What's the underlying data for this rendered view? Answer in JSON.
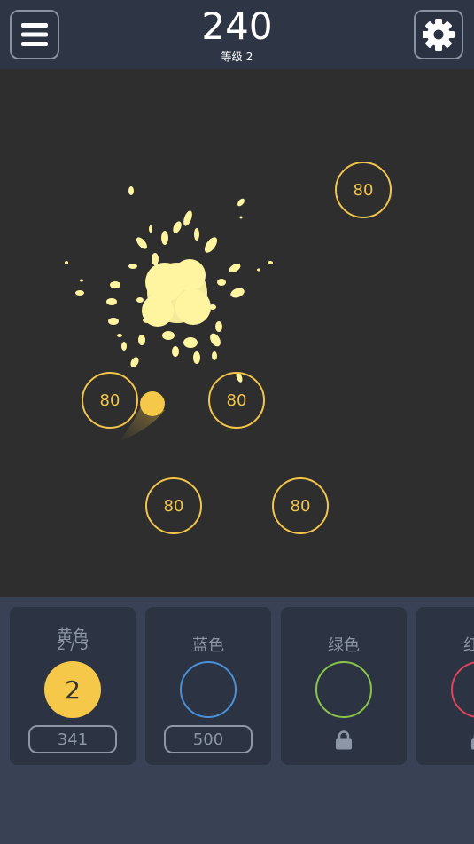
{
  "header": {
    "score": "240",
    "level_label": "等级",
    "level_value": "2",
    "menu_icon": "hamburger-menu-icon",
    "settings_icon": "gear-icon"
  },
  "field": {
    "blocks": [
      "80",
      "80",
      "80",
      "80",
      "80"
    ],
    "colors": {
      "background": "#2e2e2e",
      "block": "#f2c44a",
      "particles": "#fff5a0",
      "ball": "#f5c84a"
    }
  },
  "colors_panel": {
    "cards": [
      {
        "name": "黄色",
        "progress": "2 / 5",
        "level": "2",
        "price": "341",
        "color": "#f5c84a",
        "state": "selected"
      },
      {
        "name": "蓝色",
        "price": "500",
        "color": "#4a90d9",
        "state": "purchasable"
      },
      {
        "name": "绿色",
        "color": "#8bc34a",
        "state": "locked",
        "icon": "lock-icon"
      },
      {
        "name": "红色",
        "color": "#e0435a",
        "state": "locked",
        "icon": "lock-icon"
      }
    ]
  }
}
